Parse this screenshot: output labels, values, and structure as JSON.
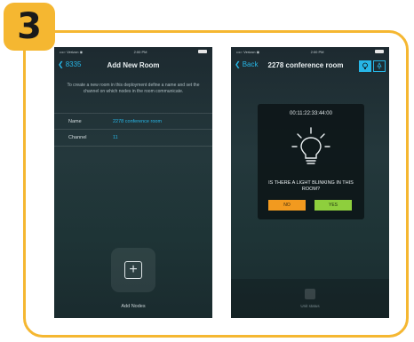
{
  "step": {
    "number": "3"
  },
  "colors": {
    "accent": "#f5b731",
    "link": "#27b6e6",
    "no": "#f29a1f",
    "yes": "#8ecf3d"
  },
  "phone1": {
    "status": {
      "carrier": "••••◦ Verizon ◉",
      "time": "2:00 PM"
    },
    "nav": {
      "back_label": "8335",
      "title": "Add New Room"
    },
    "description": "To create a new room in this deployment define a name and set the channel on which nodes in the room communicate.",
    "fields": [
      {
        "label": "Name",
        "value": "2278 conference room"
      },
      {
        "label": "Channel",
        "value": "11"
      }
    ],
    "add_button": {
      "icon": "plus-square-icon",
      "label": "Add Nodes"
    }
  },
  "phone2": {
    "status": {
      "carrier": "••••◦ Verizon ◉",
      "time": "2:00 PM"
    },
    "nav": {
      "back_label": "Back",
      "title": "2278 conference room",
      "icons": [
        "bulb-icon",
        "lamp-icon"
      ]
    },
    "dialog": {
      "id_text": "00:11:22:33:44:00",
      "icon": "lightbulb-icon",
      "question": "IS THERE A LIGHT BLINKING IN THIS ROOM?",
      "no_label": "NO",
      "yes_label": "YES"
    },
    "bottom": {
      "icon": "node-icon",
      "label": "Unit status"
    }
  }
}
